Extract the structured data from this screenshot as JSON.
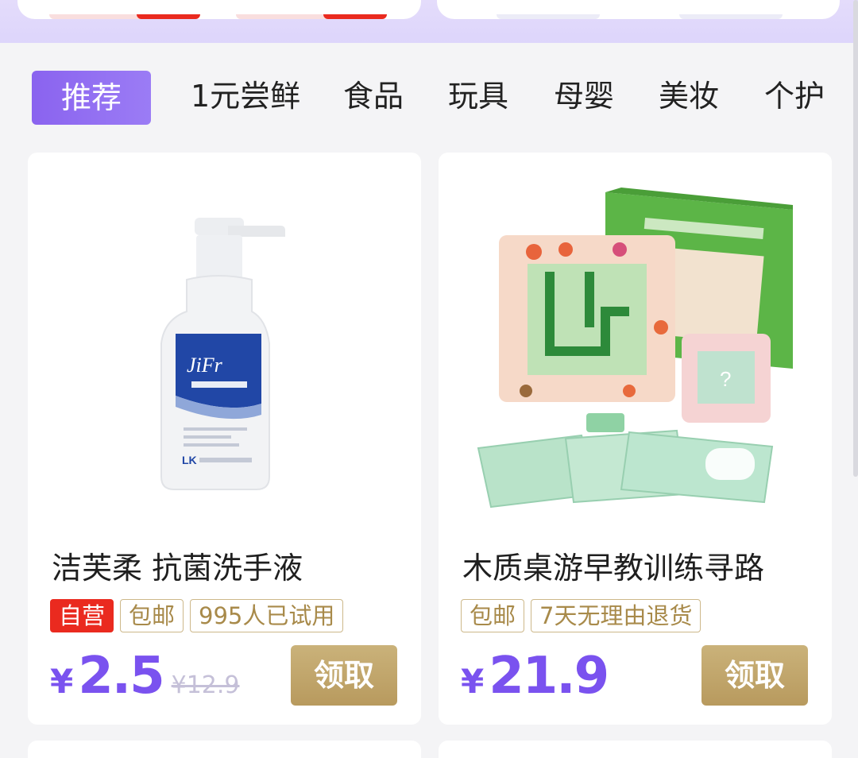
{
  "tabs": [
    {
      "label": "推荐",
      "active": true
    },
    {
      "label": "1元尝鲜"
    },
    {
      "label": "食品"
    },
    {
      "label": "玩具"
    },
    {
      "label": "母婴"
    },
    {
      "label": "美妆"
    },
    {
      "label": "个护"
    }
  ],
  "products": [
    {
      "title": "洁芙柔 抗菌洗手液",
      "image": "hand-soap-bottle",
      "tags": [
        "自营",
        "包邮",
        "995人已试用"
      ],
      "currency": "¥",
      "price": "2.5",
      "original_price": "¥12.9",
      "button": "领取"
    },
    {
      "title": "木质桌游早教训练寻路",
      "image": "wayfinding-puzzle-box",
      "tags": [
        "包邮",
        "7天无理由退货"
      ],
      "currency": "¥",
      "price": "21.9",
      "button": "领取"
    }
  ],
  "colors": {
    "accent": "#7a52ef",
    "button_gold": "#bfa468",
    "tag_red": "#ea2a1f"
  }
}
